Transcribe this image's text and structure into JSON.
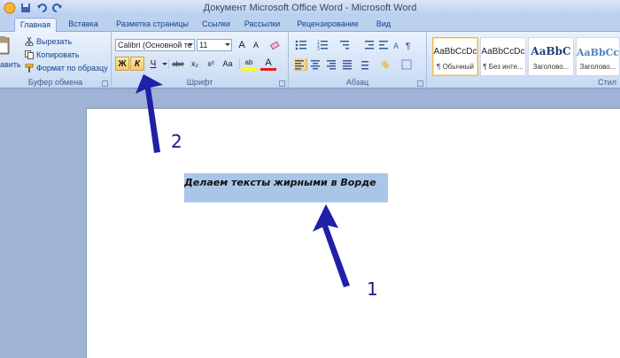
{
  "window": {
    "title": "Документ Microsoft Office Word - Microsoft Word"
  },
  "tabs": [
    {
      "label": "Главная"
    },
    {
      "label": "Вставка"
    },
    {
      "label": "Разметка страницы"
    },
    {
      "label": "Ссылки"
    },
    {
      "label": "Рассылки"
    },
    {
      "label": "Рецензирование"
    },
    {
      "label": "Вид"
    }
  ],
  "clipboard": {
    "paste_label": "авить",
    "cut": "Вырезать",
    "copy": "Копировать",
    "format_painter": "Формат по образцу",
    "group_label": "Буфер обмена"
  },
  "font": {
    "family": "Calibri (Основной те",
    "size": "11",
    "group_label": "Шрифт",
    "bold": "Ж",
    "italic": "К",
    "underline": "Ч",
    "strike": "abe",
    "subscript": "x₂",
    "superscript": "x²",
    "change_case": "Aa",
    "grow": "A",
    "shrink": "A",
    "font_color": "A",
    "highlight": "ab"
  },
  "paragraph": {
    "group_label": "Абзац"
  },
  "styles": {
    "group_label": "Стил",
    "items": [
      {
        "sample": "AaBbCcDc",
        "name": "¶ Обычный"
      },
      {
        "sample": "AaBbCcDc",
        "name": "¶ Без инте..."
      },
      {
        "sample": "AaBbC",
        "name": "Заголово..."
      },
      {
        "sample": "AaBbCc",
        "name": "Заголово..."
      }
    ]
  },
  "document": {
    "text": "Делаем тексты жирными в Ворде"
  },
  "annotations": {
    "one": "1",
    "two": "2"
  },
  "colors": {
    "accent": "#15428b",
    "arrow": "#1f1fa8",
    "selection": "#a9c6e8"
  }
}
